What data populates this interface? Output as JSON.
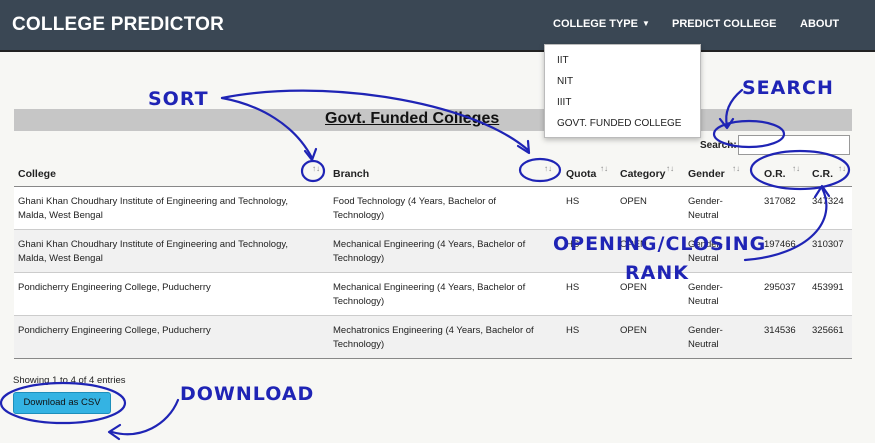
{
  "navbar": {
    "brand": "COLLEGE PREDICTOR",
    "college_type": "COLLEGE TYPE",
    "predict": "PREDICT COLLEGE",
    "about": "ABOUT"
  },
  "dropdown": [
    "IIT",
    "NIT",
    "IIIT",
    "GOVT. FUNDED COLLEGE"
  ],
  "title": "Govt. Funded Colleges",
  "search": {
    "label": "Search:",
    "value": ""
  },
  "table": {
    "headers": [
      "College",
      "Branch",
      "Quota",
      "Category",
      "Gender",
      "O.R.",
      "C.R."
    ],
    "rows": [
      {
        "college": [
          "Ghani Khan Choudhary Institute of Engineering and Technology,",
          "Malda, West Bengal"
        ],
        "branch": [
          "Food Technology (4 Years, Bachelor of",
          "Technology)"
        ],
        "quota": "HS",
        "category": "OPEN",
        "gender": [
          "Gender-",
          "Neutral"
        ],
        "or": "317082",
        "cr": "347324"
      },
      {
        "college": [
          "Ghani Khan Choudhary Institute of Engineering and Technology,",
          "Malda, West Bengal"
        ],
        "branch": [
          "Mechanical Engineering (4 Years, Bachelor of",
          "Technology)"
        ],
        "quota": "HS",
        "category": "OPEN",
        "gender": [
          "Gender-",
          "Neutral"
        ],
        "or": "197466",
        "cr": "310307"
      },
      {
        "college": [
          "Pondicherry Engineering College, Puducherry",
          ""
        ],
        "branch": [
          "Mechanical Engineering (4 Years, Bachelor of",
          "Technology)"
        ],
        "quota": "HS",
        "category": "OPEN",
        "gender": [
          "Gender-",
          "Neutral"
        ],
        "or": "295037",
        "cr": "453991"
      },
      {
        "college": [
          "Pondicherry Engineering College, Puducherry",
          ""
        ],
        "branch": [
          "Mechatronics Engineering (4 Years, Bachelor of",
          "Technology)"
        ],
        "quota": "HS",
        "category": "OPEN",
        "gender": [
          "Gender-",
          "Neutral"
        ],
        "or": "314536",
        "cr": "325661"
      }
    ]
  },
  "footer": {
    "info": "Showing 1 to 4 of 4 entries",
    "download": "Download as CSV"
  },
  "annotations": {
    "sort": "SORT",
    "search": "SEARCH",
    "rank": [
      "OPENING/CLOSING",
      "RANK"
    ],
    "download": "DOWNLOAD",
    "color": "#1f24b5"
  }
}
